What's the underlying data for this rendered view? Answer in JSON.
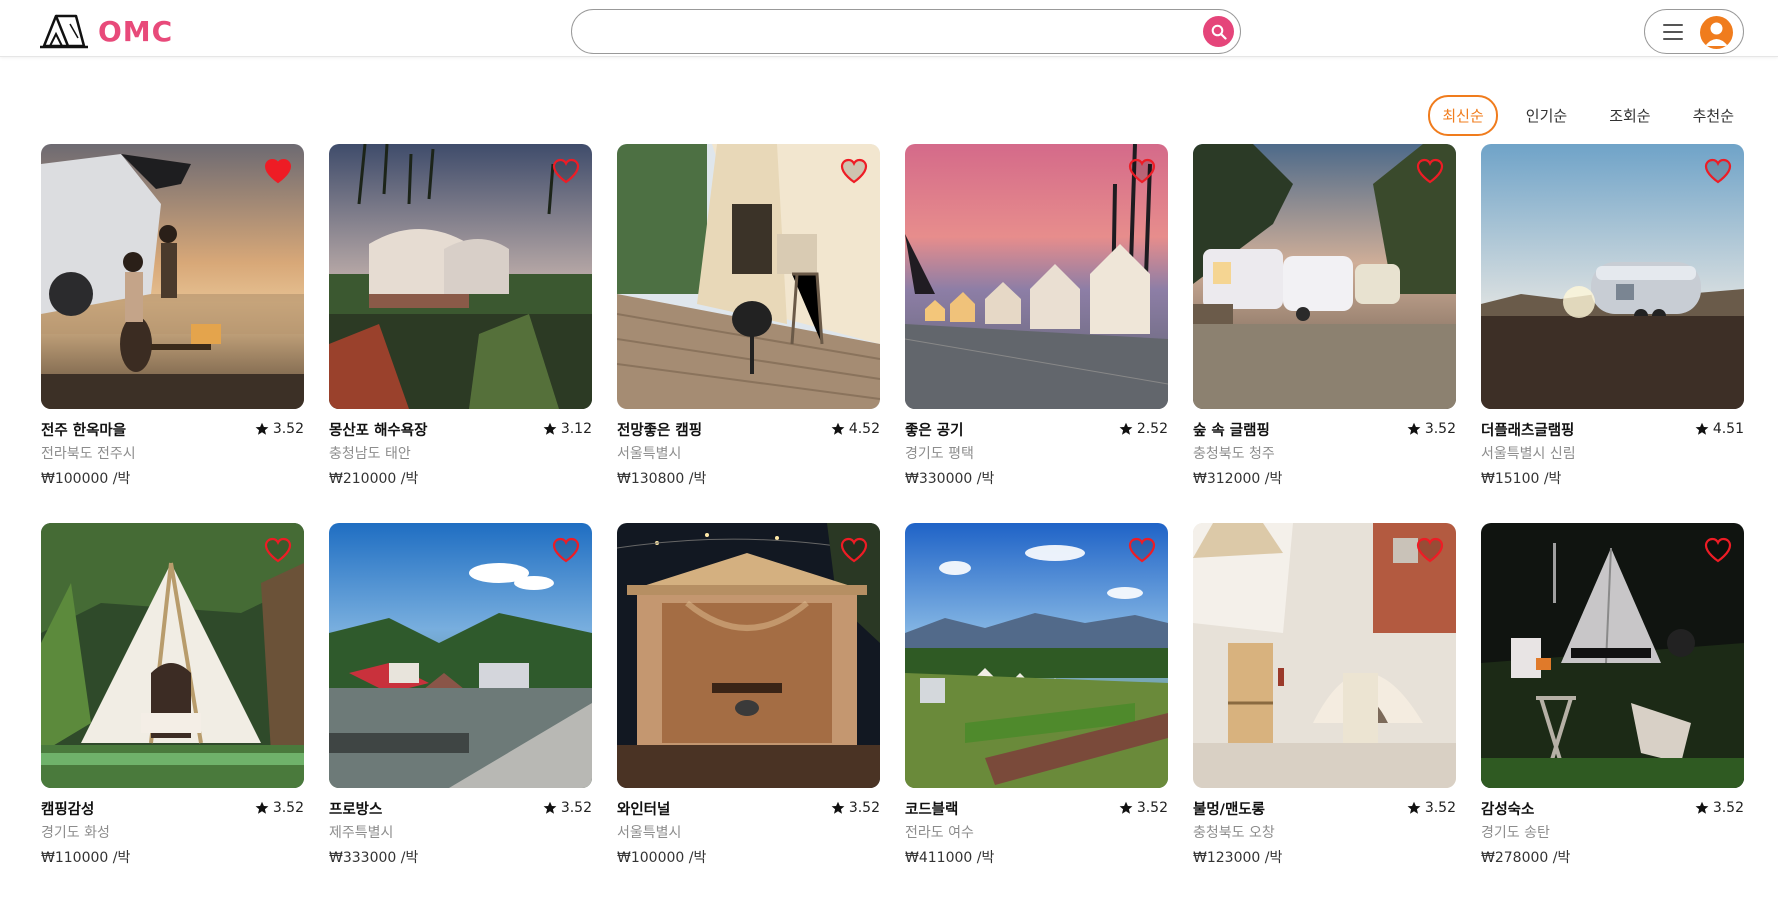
{
  "header": {
    "logo_text": "OMC",
    "search": {
      "value": "",
      "placeholder": ""
    }
  },
  "colors": {
    "brand": "#e84a7a",
    "search_button": "#e5457a",
    "accent": "#f07c1d",
    "heart_red": "#ee1c25"
  },
  "sort": {
    "options": [
      "최신순",
      "인기순",
      "조회순",
      "추천순"
    ],
    "active": "최신순"
  },
  "listings": [
    {
      "name": "전주 한옥마을",
      "rating": "3.52",
      "location": "전라북도 전주시",
      "price": "₩100000",
      "unit": "/박",
      "liked": true,
      "scene": "sunset-car"
    },
    {
      "name": "몽산포 해수욕장",
      "rating": "3.12",
      "location": "충청남도 태안",
      "price": "₩210000",
      "unit": "/박",
      "liked": false,
      "scene": "dome-tents"
    },
    {
      "name": "전망좋은 캠핑",
      "rating": "4.52",
      "location": "서울특별시",
      "price": "₩130800",
      "unit": "/박",
      "liked": false,
      "scene": "glamping-deck"
    },
    {
      "name": "좋은 공기",
      "rating": "2.52",
      "location": "경기도 평택",
      "price": "₩330000",
      "unit": "/박",
      "liked": false,
      "scene": "pink-sky-tents"
    },
    {
      "name": "숲 속 글램핑",
      "rating": "3.52",
      "location": "충청북도 청주",
      "price": "₩312000",
      "unit": "/박",
      "liked": false,
      "scene": "caravans"
    },
    {
      "name": "더플래츠글램핑",
      "rating": "4.51",
      "location": "서울특별시 신림",
      "price": "₩15100",
      "unit": "/박",
      "liked": false,
      "scene": "airstream"
    },
    {
      "name": "캠핑감성",
      "rating": "3.52",
      "location": "경기도 화성",
      "price": "₩110000",
      "unit": "/박",
      "liked": false,
      "scene": "teepee-forest"
    },
    {
      "name": "프로방스",
      "rating": "3.52",
      "location": "제주특별시",
      "price": "₩333000",
      "unit": "/박",
      "liked": false,
      "scene": "valley-campsite"
    },
    {
      "name": "와인터널",
      "rating": "3.52",
      "location": "서울특별시",
      "price": "₩100000",
      "unit": "/박",
      "liked": false,
      "scene": "gazebo-night"
    },
    {
      "name": "코드블랙",
      "rating": "3.52",
      "location": "전라도 여수",
      "price": "₩411000",
      "unit": "/박",
      "liked": false,
      "scene": "mountain-tents"
    },
    {
      "name": "불멍/맨도롱",
      "rating": "3.52",
      "location": "충청북도 오창",
      "price": "₩123000",
      "unit": "/박",
      "liked": false,
      "scene": "indoor-dome"
    },
    {
      "name": "감성숙소",
      "rating": "3.52",
      "location": "경기도 송탄",
      "price": "₩278000",
      "unit": "/박",
      "liked": false,
      "scene": "night-teepee"
    }
  ]
}
